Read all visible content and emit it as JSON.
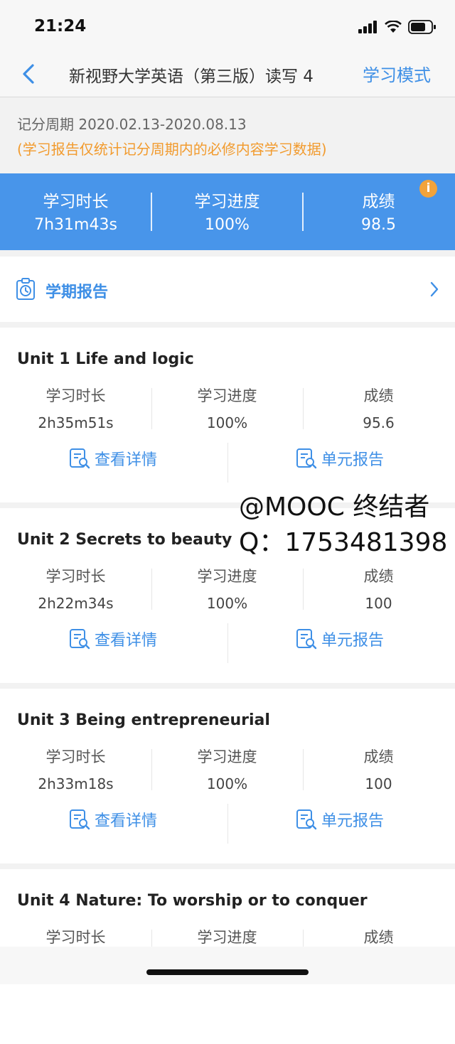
{
  "status_bar": {
    "time": "21:24"
  },
  "nav": {
    "title": "新视野大学英语（第三版）读写 4",
    "mode": "学习模式"
  },
  "period": {
    "label": "记分周期 2020.02.13-2020.08.13",
    "note": "(学习报告仅统计记分周期内的必修内容学习数据)"
  },
  "summary": {
    "time_label": "学习时长",
    "time_value": "7h31m43s",
    "progress_label": "学习进度",
    "progress_value": "100%",
    "score_label": "成绩",
    "score_value": "98.5",
    "info_icon": "i"
  },
  "term_report": {
    "label": "学期报告"
  },
  "units": [
    {
      "title": "Unit 1 Life and logic",
      "time_label": "学习时长",
      "time": "2h35m51s",
      "progress_label": "学习进度",
      "progress": "100%",
      "score_label": "成绩",
      "score": "95.6",
      "detail_label": "查看详情",
      "report_label": "单元报告"
    },
    {
      "title": "Unit 2 Secrets to beauty",
      "time_label": "学习时长",
      "time": "2h22m34s",
      "progress_label": "学习进度",
      "progress": "100%",
      "score_label": "成绩",
      "score": "100",
      "detail_label": "查看详情",
      "report_label": "单元报告"
    },
    {
      "title": "Unit 3 Being entrepreneurial",
      "time_label": "学习时长",
      "time": "2h33m18s",
      "progress_label": "学习进度",
      "progress": "100%",
      "score_label": "成绩",
      "score": "100",
      "detail_label": "查看详情",
      "report_label": "单元报告"
    },
    {
      "title": "Unit 4 Nature: To worship or to conquer",
      "time_label": "学习时长",
      "progress_label": "学习进度",
      "score_label": "成绩"
    }
  ],
  "watermark": {
    "line1": "@MOOC 终结者",
    "line2": "Q：1753481398"
  },
  "colors": {
    "accent": "#3e8fe6",
    "banner": "#4895ea",
    "note": "#f29b2e",
    "info": "#f1a33b"
  }
}
